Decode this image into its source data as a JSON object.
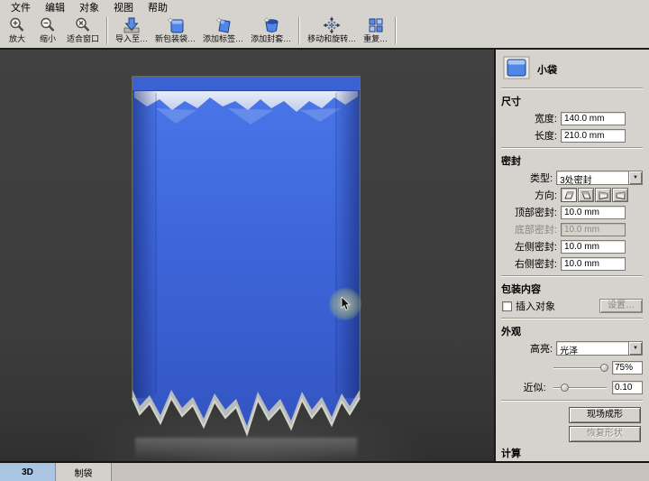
{
  "menu": {
    "items": [
      "文件",
      "编辑",
      "对象",
      "视图",
      "帮助"
    ]
  },
  "toolbar": {
    "buttons": [
      {
        "label": "放大",
        "icon": "zoom-in-icon"
      },
      {
        "label": "缩小",
        "icon": "zoom-out-icon"
      },
      {
        "label": "适合窗口",
        "icon": "fit-window-icon"
      },
      {
        "label": "导入至…",
        "icon": "import-icon"
      },
      {
        "label": "新包装袋…",
        "icon": "new-bag-icon"
      },
      {
        "label": "添加标签…",
        "icon": "add-label-icon"
      },
      {
        "label": "添加封套…",
        "icon": "add-sleeve-icon"
      },
      {
        "label": "移动和旋转…",
        "icon": "move-rotate-icon"
      },
      {
        "label": "重复…",
        "icon": "repeat-icon"
      }
    ]
  },
  "panel": {
    "title": "小袋",
    "size": {
      "title": "尺寸",
      "width_label": "宽度:",
      "width_value": "140.0 mm",
      "length_label": "长度:",
      "length_value": "210.0 mm"
    },
    "seal": {
      "title": "密封",
      "type_label": "类型:",
      "type_value": "3处密封",
      "direction_label": "方向:",
      "top_label": "顶部密封:",
      "top_value": "10.0 mm",
      "bottom_label": "底部密封:",
      "bottom_value": "10.0 mm",
      "left_label": "左侧密封:",
      "left_value": "10.0 mm",
      "right_label": "右侧密封:",
      "right_value": "10.0 mm"
    },
    "content": {
      "title": "包装内容",
      "insert_label": "插入对象",
      "settings_button": "设置…"
    },
    "appearance": {
      "title": "外观",
      "highlight_label": "高亮:",
      "highlight_value": "光泽",
      "highlight_percent": "75%",
      "approx_label": "近似:",
      "approx_value": "0.10"
    },
    "actions": {
      "live_shape": "现场成形",
      "restore_shape": "恢复形状",
      "compute_label": "计算"
    }
  },
  "tabs": {
    "items": [
      {
        "label": "3D"
      },
      {
        "label": "制袋"
      }
    ]
  },
  "colors": {
    "panel_bg": "#d6d3ce",
    "canvas_bg": "#3c3c3c",
    "bag_blue": "#3f68dd",
    "active_tab": "#a9c5e1",
    "accent_blue": "#4f86e8"
  }
}
